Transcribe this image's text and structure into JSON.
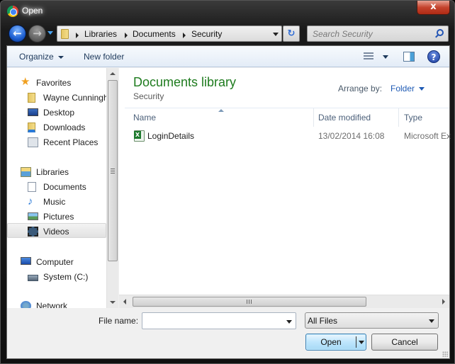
{
  "window": {
    "title": "Open",
    "close_label": "x"
  },
  "nav": {
    "back_label": "←",
    "forward_label": "→",
    "breadcrumbs": [
      "Libraries",
      "Documents",
      "Security"
    ],
    "refresh_label": "↻",
    "search_placeholder": "Search Security"
  },
  "toolbar": {
    "organize_label": "Organize",
    "new_folder_label": "New folder",
    "help_label": "?"
  },
  "sidebar": {
    "favorites": {
      "label": "Favorites",
      "items": [
        {
          "label": "Wayne Cunningham",
          "icon": "user-folder-icon"
        },
        {
          "label": "Desktop",
          "icon": "desktop-icon"
        },
        {
          "label": "Downloads",
          "icon": "downloads-icon"
        },
        {
          "label": "Recent Places",
          "icon": "recent-places-icon"
        }
      ]
    },
    "libraries": {
      "label": "Libraries",
      "items": [
        {
          "label": "Documents",
          "icon": "documents-icon",
          "selected": true
        },
        {
          "label": "Music",
          "icon": "music-icon"
        },
        {
          "label": "Pictures",
          "icon": "pictures-icon"
        },
        {
          "label": "Videos",
          "icon": "videos-icon"
        }
      ]
    },
    "computer": {
      "label": "Computer",
      "items": [
        {
          "label": "System (C:)",
          "icon": "drive-icon"
        }
      ]
    },
    "network": {
      "label": "Network"
    }
  },
  "content": {
    "library_title": "Documents library",
    "library_subtitle": "Security",
    "arrange_label": "Arrange by:",
    "arrange_value": "Folder",
    "columns": [
      "Name",
      "Date modified",
      "Type"
    ],
    "files": [
      {
        "name": "LoginDetails",
        "date_modified": "13/02/2014 16:08",
        "type": "Microsoft Ex",
        "icon": "excel-file-icon"
      }
    ]
  },
  "footer": {
    "filename_label": "File name:",
    "filename_value": "",
    "filter_value": "All Files",
    "open_label": "Open",
    "cancel_label": "Cancel"
  }
}
